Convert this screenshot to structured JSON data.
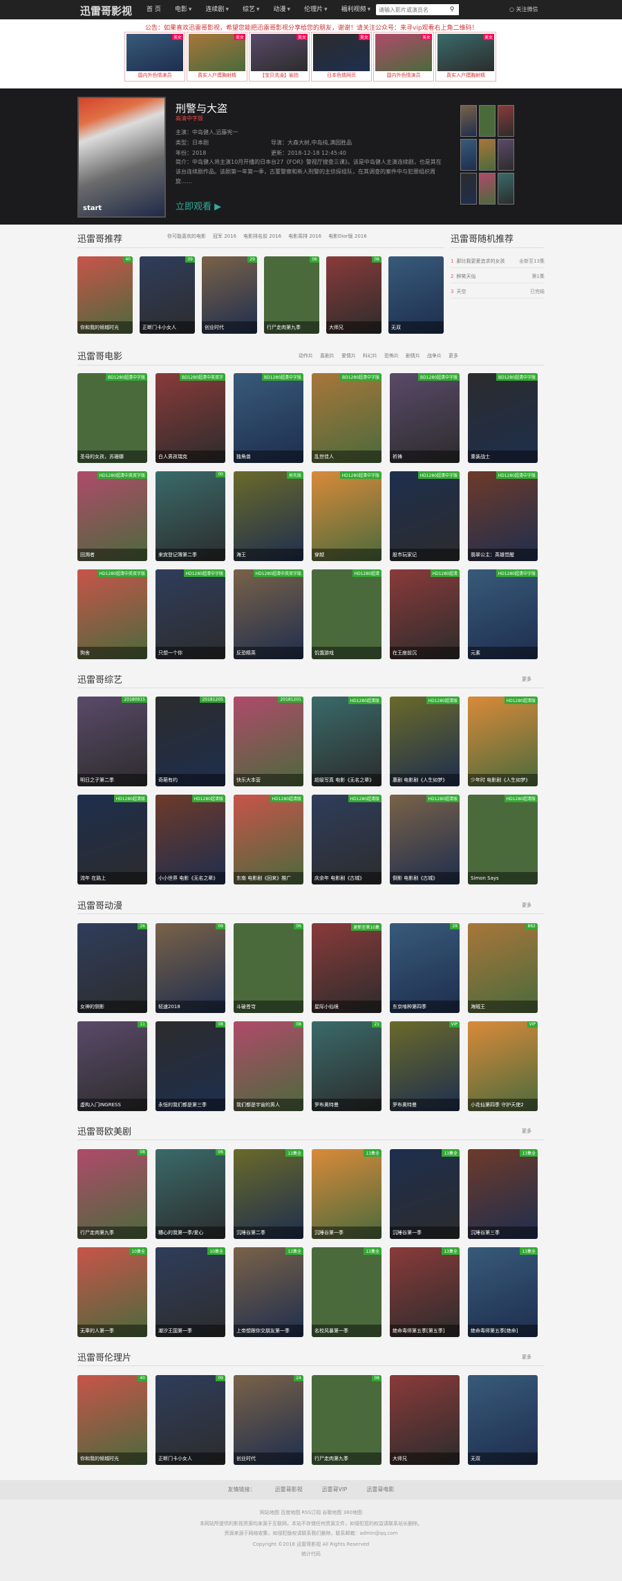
{
  "app": {
    "logo": "迅雷哥影视"
  },
  "nav": [
    {
      "label": "首 页",
      "dd": false
    },
    {
      "label": "电影",
      "dd": true
    },
    {
      "label": "连续剧",
      "dd": true
    },
    {
      "label": "综艺",
      "dd": true
    },
    {
      "label": "动漫",
      "dd": true
    },
    {
      "label": "伦理片",
      "dd": true
    },
    {
      "label": "福利视频",
      "dd": true
    }
  ],
  "search": {
    "placeholder": "请输入影片或演员名",
    "button_icon": "search-icon"
  },
  "follow": "关注微信",
  "notice": {
    "text": "公告：如果喜欢迅雷哥影视，希望您能把迅雷哥影视分享给您的朋友，谢谢！请关注公众号：来寻vip观看右上角二维码！",
    "ads": [
      {
        "label": "国内外色情演员",
        "badge": "美女"
      },
      {
        "label": "真实入户摸胸射精",
        "badge": "美女"
      },
      {
        "label": "【宝贝洗澡】偷拍",
        "badge": "美女"
      },
      {
        "label": "日本色情网页",
        "badge": "美女"
      },
      {
        "label": "国内外色情演员",
        "badge": "美女"
      },
      {
        "label": "真实入户摸胸射精",
        "badge": "美女"
      }
    ]
  },
  "hero": {
    "title": "刑警与大盗",
    "subtitle": "高清中字版",
    "poster_text": "start",
    "fields": [
      {
        "label": "主演：中岛健人,远藤宪一"
      },
      {
        "label": "类型：日本剧"
      },
      {
        "label": "年份：2018"
      },
      {
        "label": "导演：大森大树,中岛纯,满园胜品"
      },
      {
        "label": "更新：2018-12-18 12:45:40"
      }
    ],
    "desc": "简介：中岛健人将主演10月开播的日本台27《FOR》警视厅搜查三课》。该是中岛健人主演连续剧，也是其在该台连续剧作品。该剧第一年第一季，古董警察和新人刑警的主侦探组队，在其调查的案件中与犯罪组织周旋……",
    "watch": "立即观看",
    "watch_icon": "play-icon"
  },
  "rec": {
    "title": "迅雷哥推荐",
    "tabs": [
      "你可能喜欢的电影",
      "冠军 2016",
      "电影排名前 2016",
      "电影周排 2016",
      "电影Dior版 2016"
    ],
    "items": [
      {
        "title": "你和我的倾城时光",
        "badge": "40"
      },
      {
        "title": "正断门卡小女人",
        "badge": "09"
      },
      {
        "title": "创业时代",
        "badge": "29"
      },
      {
        "title": "行尸走肉第九季",
        "badge": "06"
      },
      {
        "title": "大师兄",
        "badge": "08"
      },
      {
        "title": "无双",
        "badge": ""
      }
    ]
  },
  "rand": {
    "title": "迅雷哥随机推荐",
    "items": [
      {
        "n": "1",
        "title": "那比我更爱追求的女孩",
        "score": "全新至13集"
      },
      {
        "n": "2",
        "title": "醉笑天仙",
        "score": "第1集"
      },
      {
        "n": "3",
        "title": "天空",
        "score": "已完结"
      }
    ]
  },
  "movie": {
    "title": "迅雷哥电影",
    "tabs": [
      "动作片",
      "喜剧片",
      "爱情片",
      "科幻片",
      "恐怖片",
      "剧情片",
      "战争片",
      "更多"
    ],
    "items": [
      {
        "title": "圣母的女孩，苏珊娜",
        "badge": "BD1280超清中字版"
      },
      {
        "title": "白人男孩瑞克",
        "badge": "BD1280超清中英双字"
      },
      {
        "title": "独角兽",
        "badge": "BD1280超清中字版"
      },
      {
        "title": "乱世佳人",
        "badge": "BD1280超清中字版"
      },
      {
        "title": "祈祷",
        "badge": "BD1280超清中字版"
      },
      {
        "title": "重装战士",
        "badge": "BD1280超清中字版"
      },
      {
        "title": "回溯者",
        "badge": "HD1280超清中英双字版"
      },
      {
        "title": "来宾登记簿第二季",
        "badge": "00"
      },
      {
        "title": "海王",
        "badge": "抢先版"
      },
      {
        "title": "穿越",
        "badge": "HD1280超清中字版"
      },
      {
        "title": "股市玩家记",
        "badge": "HD1280超清中字版"
      },
      {
        "title": "翡翠公主：英雄觉醒",
        "badge": "HD1280超清中字版"
      },
      {
        "title": "狗舍",
        "badge": "HD1280超清中英双字版"
      },
      {
        "title": "只想一个你",
        "badge": "HD1280超清中字版"
      },
      {
        "title": "反恐精英",
        "badge": "HD1280超清中英双字版"
      },
      {
        "title": "饥饿游戏",
        "badge": "HD1280超清"
      },
      {
        "title": "在王座前沉",
        "badge": "HD1280超清"
      },
      {
        "title": "元素",
        "badge": "HD1280超清中字版"
      }
    ]
  },
  "variety": {
    "title": "迅雷哥综艺",
    "more": "更多",
    "items": [
      {
        "title": "明日之子第二季",
        "badge": "20180915"
      },
      {
        "title": "奇葩有约",
        "badge": "20181205"
      },
      {
        "title": "快乐大本营",
        "badge": "20181201"
      },
      {
        "title": "超级写真 电影《无名之辈》",
        "badge": "HD1280超清版"
      },
      {
        "title": "惠剧 电影剧《人生如梦》",
        "badge": "HD1280超清版"
      },
      {
        "title": "少年时 电影剧《人生如梦》",
        "badge": "HD1280超清版"
      },
      {
        "title": "流年 在路上",
        "badge": "HD1280超清版"
      },
      {
        "title": "小小世界 电影《无名之辈》",
        "badge": "HD1280超清版"
      },
      {
        "title": "东南 电影剧《回来》推广",
        "badge": "HD1280超清版"
      },
      {
        "title": "庆余年 电影剧《古城》",
        "badge": "HD1280超清版"
      },
      {
        "title": "倒影 电影剧《古城》",
        "badge": "HD1280超清版"
      },
      {
        "title": "Simon Says",
        "badge": "HD1280超清版"
      }
    ]
  },
  "anime": {
    "title": "迅雷哥动漫",
    "more": "更多",
    "items": [
      {
        "title": "女神的侧影",
        "badge": "26"
      },
      {
        "title": "轻速2018",
        "badge": "09"
      },
      {
        "title": "斗破苍穹",
        "badge": "06"
      },
      {
        "title": "星际小仙境",
        "badge": "更新至第10集"
      },
      {
        "title": "东京喰种第四季",
        "badge": "29"
      },
      {
        "title": "海贼王",
        "badge": "862"
      },
      {
        "title": "虚构入门INGRESS",
        "badge": "11"
      },
      {
        "title": "永恒的我们都是第三季",
        "badge": "08"
      },
      {
        "title": "我们都是宇宙的男人",
        "badge": "08"
      },
      {
        "title": "罗布奥特曼",
        "badge": "21"
      },
      {
        "title": "罗布奥特曼",
        "badge": "VIP"
      },
      {
        "title": "小花仙第四季 守护天使2",
        "badge": "VIP"
      }
    ]
  },
  "western": {
    "title": "迅雷哥欧美剧",
    "more": "更多",
    "items": [
      {
        "title": "行尸走肉第九季",
        "badge": "08"
      },
      {
        "title": "糟心的我第一季/爱心",
        "badge": "06"
      },
      {
        "title": "沉睡谷第二季",
        "badge": "13集全"
      },
      {
        "title": "沉睡谷第一季",
        "badge": "13集全"
      },
      {
        "title": "沉睡谷第一季",
        "badge": "13集全"
      },
      {
        "title": "沉睡谷第三季",
        "badge": "13集全"
      },
      {
        "title": "无辜的人第一季",
        "badge": "10集全"
      },
      {
        "title": "潮汐王国第一季",
        "badge": "10集全"
      },
      {
        "title": "上帝想跟你交朋友第一季",
        "badge": "13集全"
      },
      {
        "title": "名校风暴第一季",
        "badge": "13集全"
      },
      {
        "title": "绝命毒师第五季[第五季]",
        "badge": "13集全"
      },
      {
        "title": "绝命毒师第五季[绝命]",
        "badge": "13集全"
      }
    ]
  },
  "ethics": {
    "title": "迅雷哥伦理片",
    "more": "更多",
    "items": [
      {
        "title": "你和我的倾城时光",
        "badge": "40"
      },
      {
        "title": "正断门卡小女人",
        "badge": "09"
      },
      {
        "title": "创业时代",
        "badge": "24"
      },
      {
        "title": "行尸走肉第九季",
        "badge": "08"
      },
      {
        "title": "大师兄",
        "badge": ""
      },
      {
        "title": "无双",
        "badge": ""
      }
    ]
  },
  "footer": {
    "links_label": "友情链接：",
    "links": [
      "迅雷哥影视",
      "迅雷哥VIP",
      "迅雷哥电影"
    ],
    "line1": "网站地图  百度地图  RSS订阅  谷歌地图  360地图",
    "line2": "本网站所提供的影视资源均来源于互联网，本站不存储任何资源文件，如侵犯您的权益请联系站长删除。",
    "line3": "资源来源于网络收集，如侵犯版权请联系我们删除，联系邮箱：admin@qq.com",
    "line4": "Copyright ©2018 迅雷哥影视 All Rights Reserved",
    "line5": "统计代码"
  }
}
